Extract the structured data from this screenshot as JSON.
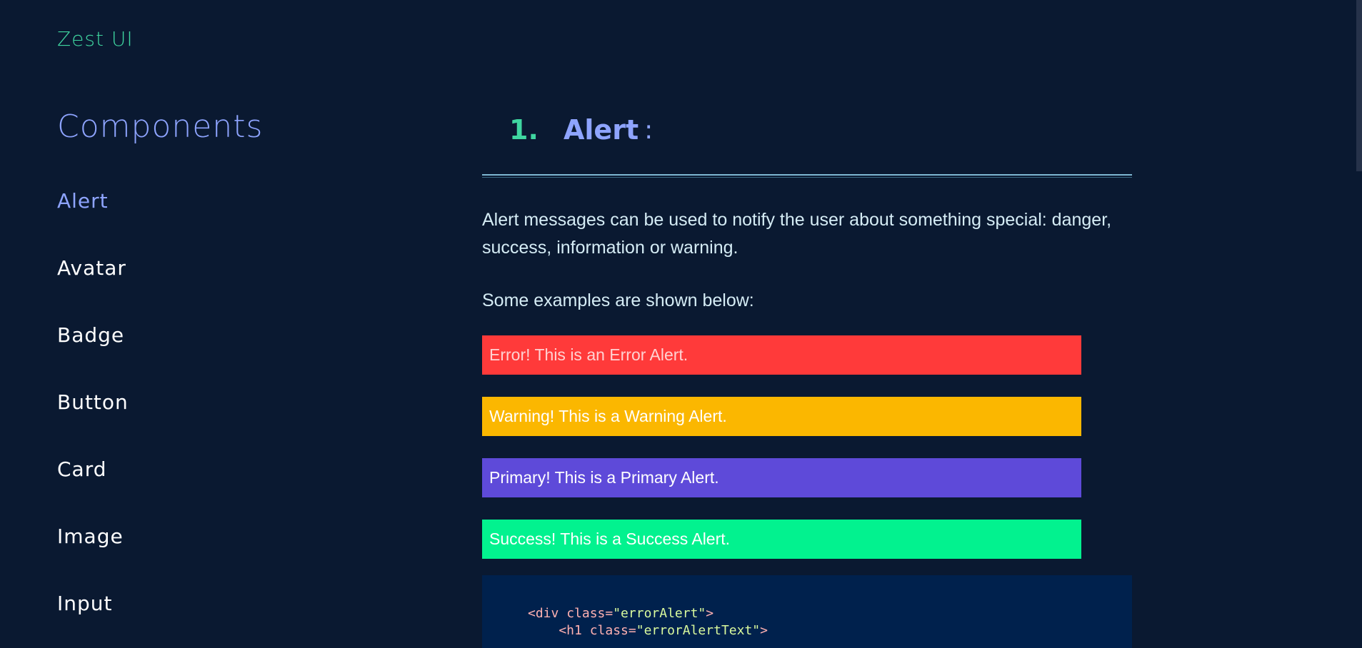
{
  "brand": "Zest UI",
  "sidebar": {
    "title": "Components",
    "items": [
      {
        "label": "Alert",
        "active": true
      },
      {
        "label": "Avatar",
        "active": false
      },
      {
        "label": "Badge",
        "active": false
      },
      {
        "label": "Button",
        "active": false
      },
      {
        "label": "Card",
        "active": false
      },
      {
        "label": "Image",
        "active": false
      },
      {
        "label": "Input",
        "active": false
      }
    ]
  },
  "section": {
    "number": "1.",
    "title": "Alert",
    "colon": ":",
    "description": "Alert messages can be used to notify the user about something special: danger, success, information or warning.",
    "examples_intro": "Some examples are shown below:",
    "alerts": [
      {
        "type": "error",
        "text": "Error! This is an Error Alert.",
        "color": "#ff3a3a"
      },
      {
        "type": "warning",
        "text": "Warning! This is a Warning Alert.",
        "color": "#fbb700"
      },
      {
        "type": "primary",
        "text": "Primary! This is a Primary Alert.",
        "color": "#5e4ad9"
      },
      {
        "type": "success",
        "text": "Success! This is a Success Alert.",
        "color": "#02f28f"
      }
    ],
    "code": {
      "line1_open": "<div ",
      "line1_attr": "class=",
      "line1_val": "\"errorAlert\"",
      "line1_close": ">",
      "line2_open": "    <h1 ",
      "line2_attr": "class=",
      "line2_val": "\"errorAlertText\"",
      "line2_close": ">"
    }
  },
  "colors": {
    "background": "#0a1931",
    "accent_green": "#3fd6a0",
    "accent_blue": "#8ea4ff",
    "code_bg": "#00214d"
  }
}
